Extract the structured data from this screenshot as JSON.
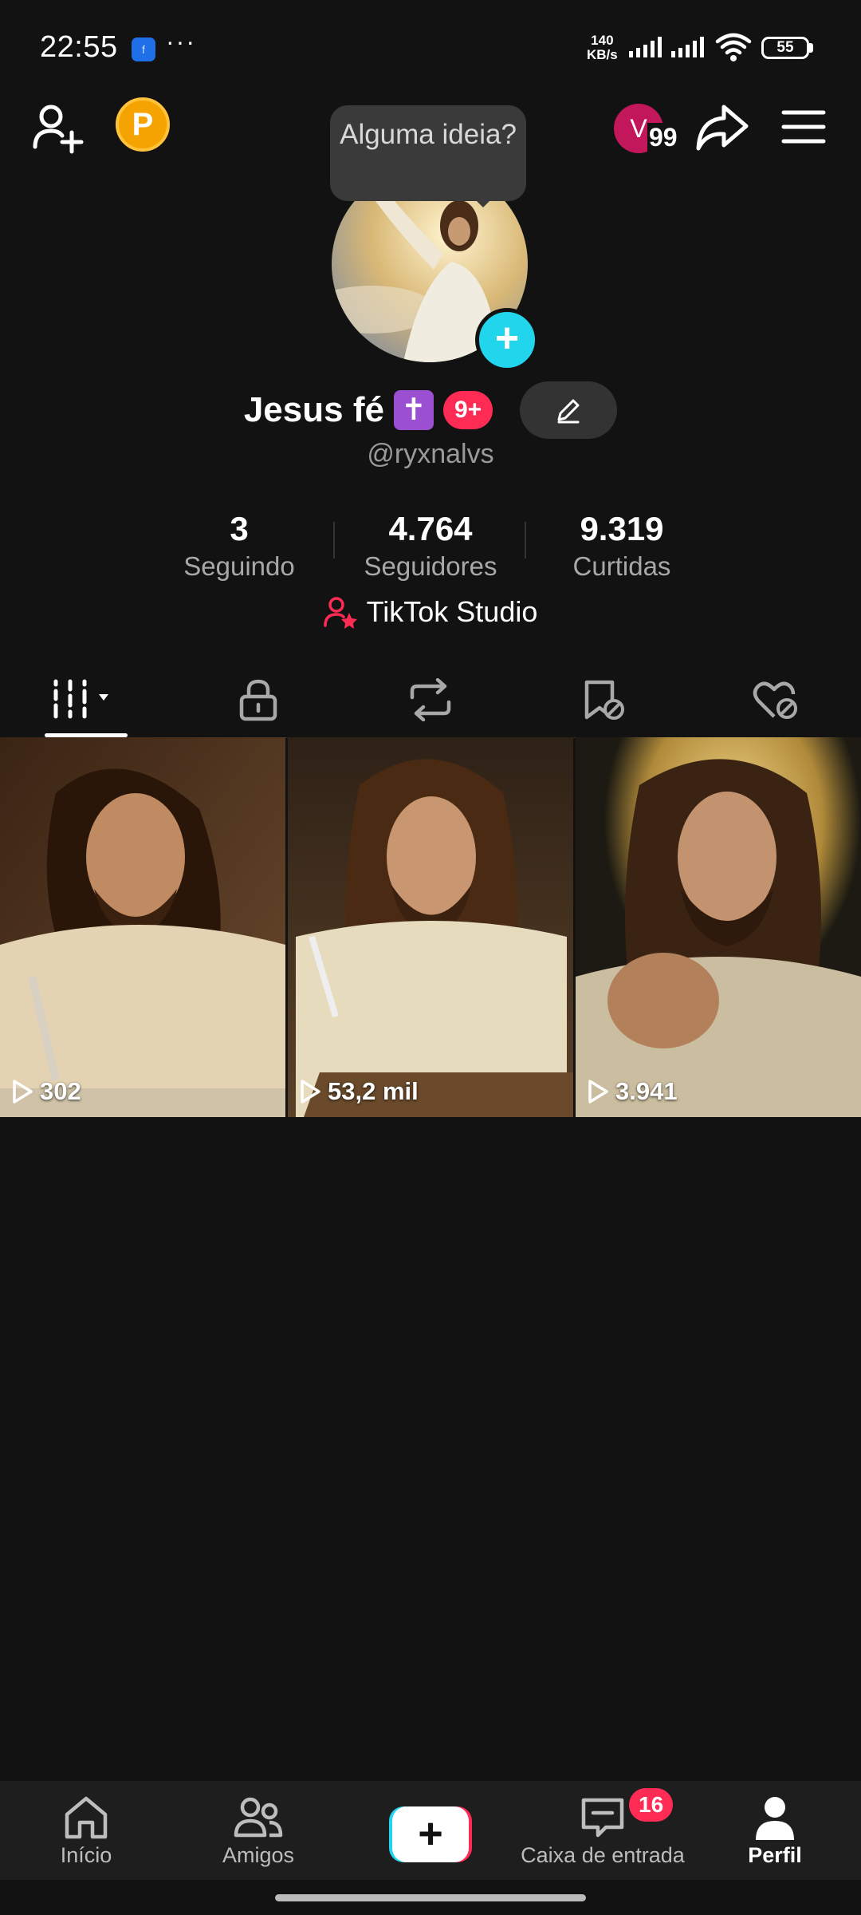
{
  "status_bar": {
    "time": "22:55",
    "app_icon": "f",
    "more": "···",
    "net_speed_value": "140",
    "net_speed_unit": "KB/s",
    "battery": "55"
  },
  "header": {
    "tooltip": "Alguma ideia?",
    "visitor_initial": "V",
    "visitor_count": "99",
    "coin_letter": "P"
  },
  "profile": {
    "display_name": "Jesus fé",
    "name_emoji": "✝",
    "name_badge": "9+",
    "handle": "@ryxnalvs",
    "avatar_add": "+"
  },
  "stats": [
    {
      "value": "3",
      "label": "Seguindo"
    },
    {
      "value": "4.764",
      "label": "Seguidores"
    },
    {
      "value": "9.319",
      "label": "Curtidas"
    }
  ],
  "studio_label": "TikTok Studio",
  "tabs": [
    {
      "icon": "grid-icon",
      "active": true
    },
    {
      "icon": "lock-icon",
      "active": false
    },
    {
      "icon": "repost-icon",
      "active": false
    },
    {
      "icon": "bookmark-hidden-icon",
      "active": false
    },
    {
      "icon": "heart-hidden-icon",
      "active": false
    }
  ],
  "videos": [
    {
      "views": "302"
    },
    {
      "views": "53,2 mil"
    },
    {
      "views": "3.941"
    }
  ],
  "bottom_nav": {
    "home": "Início",
    "friends": "Amigos",
    "create": "+",
    "inbox": "Caixa de entrada",
    "inbox_badge": "16",
    "profile": "Perfil"
  },
  "colors": {
    "background": "#121212",
    "accent_pink": "#fe2c55",
    "accent_cyan": "#20d5ec",
    "coin": "#f5a300"
  }
}
